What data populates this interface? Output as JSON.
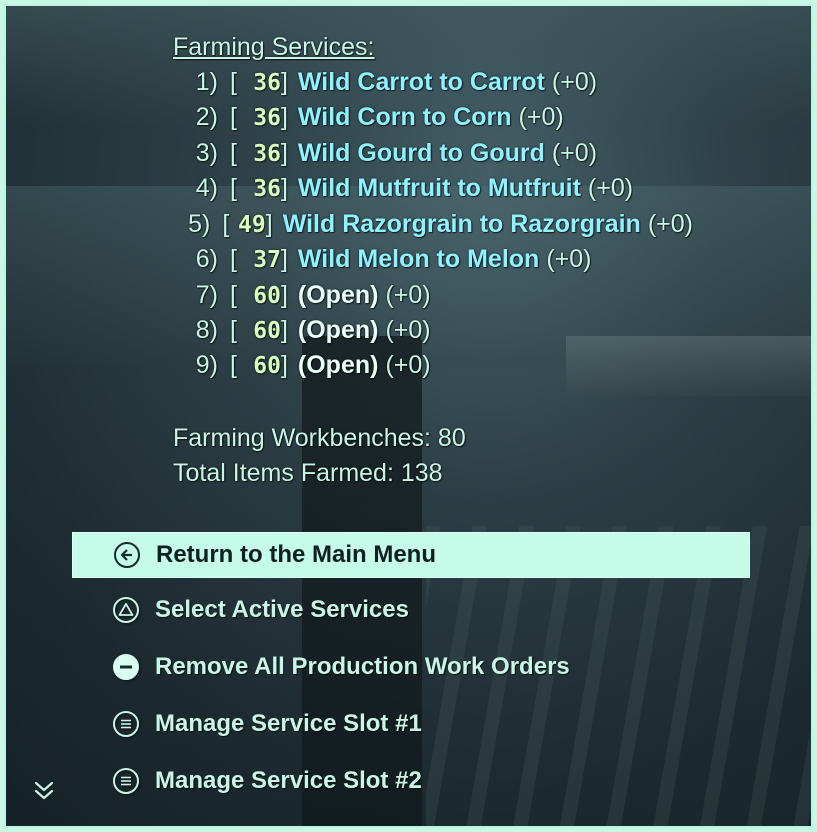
{
  "services": {
    "title": "Farming Services:",
    "rows": [
      {
        "index": "1)",
        "open_bracket": "[",
        "level": "36",
        "close_bracket": "]",
        "name": "Wild Carrot to Carrot",
        "bonus": "(+0)",
        "open": false
      },
      {
        "index": "2)",
        "open_bracket": "[",
        "level": "36",
        "close_bracket": "]",
        "name": "Wild Corn to Corn",
        "bonus": "(+0)",
        "open": false
      },
      {
        "index": "3)",
        "open_bracket": "[",
        "level": "36",
        "close_bracket": "]",
        "name": "Wild Gourd to Gourd",
        "bonus": "(+0)",
        "open": false
      },
      {
        "index": "4)",
        "open_bracket": "[",
        "level": "36",
        "close_bracket": "]",
        "name": "Wild Mutfruit to Mutfruit",
        "bonus": "(+0)",
        "open": false
      },
      {
        "index": "5)",
        "open_bracket": "[",
        "level": "49",
        "close_bracket": "]",
        "name": "Wild Razorgrain to Razorgrain",
        "bonus": "(+0)",
        "open": false
      },
      {
        "index": "6)",
        "open_bracket": "[",
        "level": "37",
        "close_bracket": "]",
        "name": "Wild Melon to Melon",
        "bonus": "(+0)",
        "open": false
      },
      {
        "index": "7)",
        "open_bracket": "[",
        "level": "60",
        "close_bracket": "]",
        "name": "(Open)",
        "bonus": "(+0)",
        "open": true
      },
      {
        "index": "8)",
        "open_bracket": "[",
        "level": "60",
        "close_bracket": "]",
        "name": "(Open)",
        "bonus": "(+0)",
        "open": true
      },
      {
        "index": "9)",
        "open_bracket": "[",
        "level": "60",
        "close_bracket": "]",
        "name": "(Open)",
        "bonus": "(+0)",
        "open": true
      }
    ]
  },
  "stats": {
    "workbenches": "Farming Workbenches: 80",
    "total_farmed": "Total Items Farmed: 138"
  },
  "menu": {
    "items": [
      {
        "label": "Return to the Main Menu",
        "icon": "back-arrow-icon",
        "selected": true
      },
      {
        "label": "Select Active Services",
        "icon": "triangle-icon",
        "selected": false
      },
      {
        "label": "Remove All Production Work Orders",
        "icon": "minus-icon",
        "selected": false
      },
      {
        "label": "Manage Service Slot #1",
        "icon": "list-icon",
        "selected": false
      },
      {
        "label": "Manage Service Slot #2",
        "icon": "list-icon",
        "selected": false
      }
    ]
  },
  "colors": {
    "text": "#c9f6e6",
    "service_name": "#8ef3ff",
    "level": "#d6ffc0",
    "selection_bg": "#c4fbe9",
    "frame": "#bdf5e3"
  }
}
